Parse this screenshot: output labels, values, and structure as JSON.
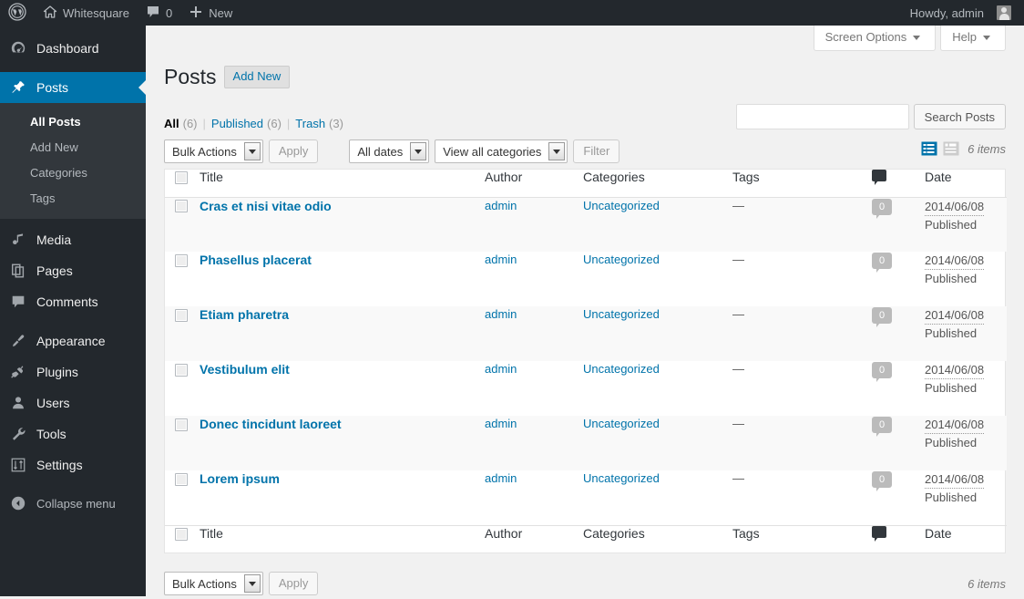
{
  "adminbar": {
    "logo_icon": "wordpress-logo-icon",
    "home_icon": "home-icon",
    "site_name": "Whitesquare",
    "comments_icon": "comment-icon",
    "comments_count": "0",
    "new_icon": "plus-icon",
    "new_label": "New",
    "howdy": "Howdy, admin",
    "avatar_icon": "avatar-icon"
  },
  "sidebar": {
    "items": [
      {
        "label": "Dashboard",
        "icon": "dashboard-icon",
        "name": "dashboard"
      },
      {
        "label": "Posts",
        "icon": "pin-icon",
        "name": "posts"
      },
      {
        "label": "Media",
        "icon": "media-icon",
        "name": "media"
      },
      {
        "label": "Pages",
        "icon": "pages-icon",
        "name": "pages"
      },
      {
        "label": "Comments",
        "icon": "comment-icon",
        "name": "comments"
      },
      {
        "label": "Appearance",
        "icon": "brush-icon",
        "name": "appearance"
      },
      {
        "label": "Plugins",
        "icon": "plug-icon",
        "name": "plugins"
      },
      {
        "label": "Users",
        "icon": "user-icon",
        "name": "users"
      },
      {
        "label": "Tools",
        "icon": "wrench-icon",
        "name": "tools"
      },
      {
        "label": "Settings",
        "icon": "sliders-icon",
        "name": "settings"
      }
    ],
    "submenu": [
      {
        "label": "All Posts",
        "current": true
      },
      {
        "label": "Add New",
        "current": false
      },
      {
        "label": "Categories",
        "current": false
      },
      {
        "label": "Tags",
        "current": false
      }
    ],
    "collapse": {
      "label": "Collapse menu",
      "icon": "collapse-arrow-icon"
    },
    "accent_color": "#0073aa",
    "bg_color": "#23282d",
    "submenu_bg_color": "#32373c"
  },
  "screen_meta": {
    "screen_options": "Screen Options",
    "help": "Help"
  },
  "page": {
    "title": "Posts",
    "add_new": "Add New"
  },
  "filters": {
    "all_label": "All",
    "all_count": "(6)",
    "published_label": "Published",
    "published_count": "(6)",
    "trash_label": "Trash",
    "trash_count": "(3)",
    "separator": "|"
  },
  "search": {
    "value": "",
    "placeholder": "",
    "button": "Search Posts"
  },
  "tablenav": {
    "bulk_actions": "Bulk Actions",
    "apply": "Apply",
    "all_dates": "All dates",
    "view_all_categories": "View all categories",
    "filter": "Filter",
    "items_count": "6 items",
    "list_view_icon": "list-view-icon",
    "excerpt_view_icon": "excerpt-view-icon"
  },
  "table": {
    "columns": {
      "title": "Title",
      "author": "Author",
      "categories": "Categories",
      "tags": "Tags",
      "comments_icon": "comment-icon",
      "date": "Date"
    },
    "rows": [
      {
        "title": "Cras et nisi vitae odio",
        "author": "admin",
        "category": "Uncategorized",
        "tags": "—",
        "comments": "0",
        "date": "2014/06/08",
        "status": "Published"
      },
      {
        "title": "Phasellus placerat",
        "author": "admin",
        "category": "Uncategorized",
        "tags": "—",
        "comments": "0",
        "date": "2014/06/08",
        "status": "Published"
      },
      {
        "title": "Etiam pharetra",
        "author": "admin",
        "category": "Uncategorized",
        "tags": "—",
        "comments": "0",
        "date": "2014/06/08",
        "status": "Published"
      },
      {
        "title": "Vestibulum elit",
        "author": "admin",
        "category": "Uncategorized",
        "tags": "—",
        "comments": "0",
        "date": "2014/06/08",
        "status": "Published"
      },
      {
        "title": "Donec tincidunt laoreet",
        "author": "admin",
        "category": "Uncategorized",
        "tags": "—",
        "comments": "0",
        "date": "2014/06/08",
        "status": "Published"
      },
      {
        "title": "Lorem ipsum",
        "author": "admin",
        "category": "Uncategorized",
        "tags": "—",
        "comments": "0",
        "date": "2014/06/08",
        "status": "Published"
      }
    ]
  },
  "tablenav_bottom": {
    "bulk_actions": "Bulk Actions",
    "apply": "Apply",
    "items_count": "6 items"
  }
}
